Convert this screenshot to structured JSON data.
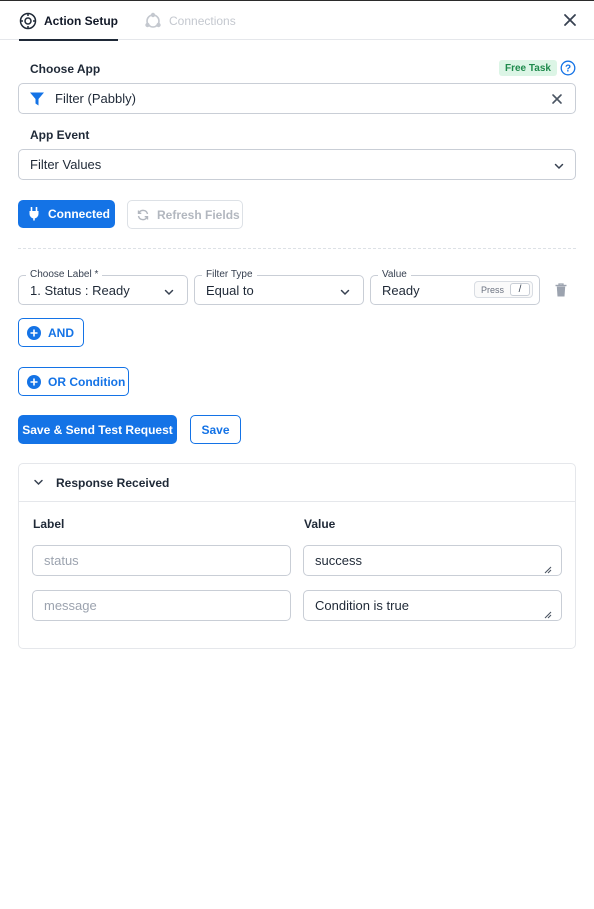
{
  "tabs": {
    "active": "Action Setup",
    "inactive": "Connections"
  },
  "choose_app": {
    "title": "Choose App",
    "badge": "Free Task",
    "value": "Filter (Pabbly)"
  },
  "app_event": {
    "title": "App Event",
    "value": "Filter Values"
  },
  "buttons": {
    "connected": "Connected",
    "refresh": "Refresh Fields",
    "and": "AND",
    "or": "OR Condition",
    "save_send": "Save & Send Test Request",
    "save": "Save"
  },
  "condition": {
    "label_legend": "Choose Label *",
    "label_value": "1. Status : Ready",
    "type_legend": "Filter Type",
    "type_value": "Equal to",
    "value_legend": "Value",
    "value_value": "Ready",
    "press_hint": "Press",
    "press_key": "/"
  },
  "response": {
    "title": "Response Received",
    "col_label": "Label",
    "col_value": "Value",
    "rows": [
      {
        "label": "status",
        "value": "success"
      },
      {
        "label": "message",
        "value": "Condition is true"
      }
    ]
  },
  "colors": {
    "primary": "#1473e6",
    "badge_bg": "#dcf5e6",
    "badge_text": "#1e8a4c"
  },
  "icons": [
    "action-setup-icon",
    "connections-icon",
    "close-icon",
    "help-icon",
    "filter-icon",
    "clear-icon",
    "chevron-down-icon",
    "plug-icon",
    "refresh-icon",
    "trash-icon",
    "plus-circle-icon",
    "resize-grip-icon"
  ]
}
